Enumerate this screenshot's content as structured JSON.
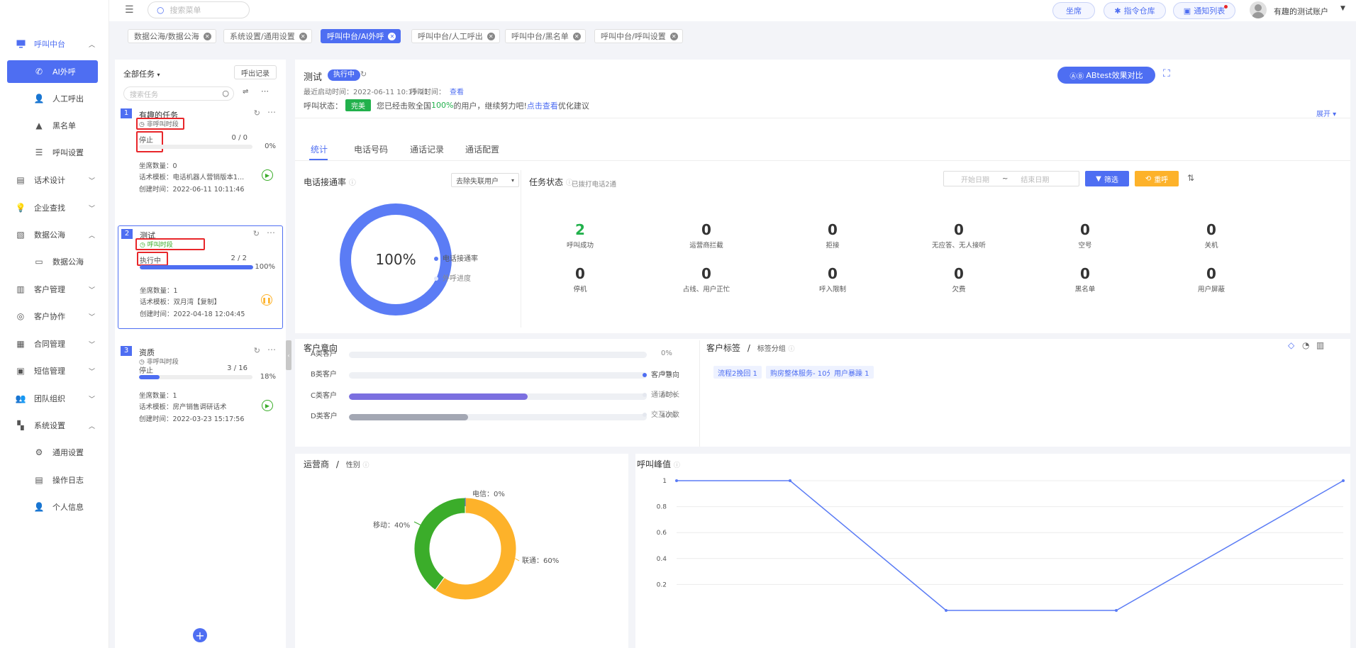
{
  "sidebar": {
    "items": [
      {
        "label": "呼叫中台",
        "icon": "monitor-icon",
        "chev": "^"
      },
      {
        "label": "AI外呼",
        "icon": "phone-icon"
      },
      {
        "label": "人工呼出",
        "icon": "person-icon"
      },
      {
        "label": "黑名单",
        "icon": "warning-icon"
      },
      {
        "label": "呼叫设置",
        "icon": "sliders-icon"
      },
      {
        "label": "话术设计",
        "icon": "book-icon",
        "chev": "v"
      },
      {
        "label": "企业查找",
        "icon": "bulb-icon",
        "chev": "v"
      },
      {
        "label": "数据公海",
        "icon": "chart-icon",
        "chev": "^"
      },
      {
        "label": "数据公海",
        "icon": "laptop-icon"
      },
      {
        "label": "客户管理",
        "icon": "contacts-icon",
        "chev": "v"
      },
      {
        "label": "客户协作",
        "icon": "team-icon",
        "chev": "v"
      },
      {
        "label": "合同管理",
        "icon": "clipboard-icon",
        "chev": "v"
      },
      {
        "label": "短信管理",
        "icon": "message-icon",
        "chev": "v"
      },
      {
        "label": "团队组织",
        "icon": "group-icon",
        "chev": "v"
      },
      {
        "label": "系统设置",
        "icon": "grid-icon",
        "chev": "^"
      },
      {
        "label": "通用设置",
        "icon": "gear-icon"
      },
      {
        "label": "操作日志",
        "icon": "doc-icon"
      },
      {
        "label": "个人信息",
        "icon": "user-icon"
      }
    ]
  },
  "topbar": {
    "search_placeholder": "搜索菜单",
    "seat": "坐席",
    "cmd": "指令仓库",
    "notify": "通知列表",
    "account": "有趣的测试账户"
  },
  "tags": [
    "数据公海/数据公海",
    "系统设置/通用设置",
    "呼叫中台/AI外呼",
    "呼叫中台/人工呼出",
    "呼叫中台/黑名单",
    "呼叫中台/呼叫设置"
  ],
  "left": {
    "filter": "全部任务",
    "export": "呼出记录",
    "search_placeholder": "搜索任务",
    "tasks": [
      {
        "num": "1",
        "title": "有趣的任务",
        "time_label": "非呼叫时段",
        "status": "停止",
        "progress": "0 / 0",
        "pct": "0%",
        "fill": 0,
        "seats": "坐席数量：0",
        "template": "话术模板：电话机器人营销版本1...",
        "created": "创建时间：2022-06-11 10:11:46"
      },
      {
        "num": "2",
        "title": "测试",
        "time_label": "呼叫时段",
        "status": "执行中",
        "progress": "2 / 2",
        "pct": "100%",
        "fill": 100,
        "seats": "坐席数量：1",
        "template": "话术模板：双月湾【复制】",
        "created": "创建时间：2022-04-18 12:04:45"
      },
      {
        "num": "3",
        "title": "资质",
        "time_label": "非呼叫时段",
        "status": "停止",
        "progress": "3 / 16",
        "pct": "18%",
        "fill": 18,
        "seats": "坐席数量：1",
        "template": "话术模板：房产销售调研话术",
        "created": "创建时间：2022-03-23 15:17:56"
      }
    ]
  },
  "main": {
    "title": "测试",
    "badge": "执行中",
    "recent_start": "最近启动时间：2022-06-11 10:19:21",
    "call_time_label": "呼叫时间：",
    "call_time_link": "查看",
    "call_status_label": "呼叫状态：",
    "call_status_badge": "完美",
    "call_status_msg1": "您已经击败全国",
    "call_status_pct": "100%",
    "call_status_msg2": "的用户，继续努力吧!",
    "call_status_link": "点击查看",
    "call_status_msg3": "优化建议",
    "ab_btn": "ABtest效果对比",
    "expand": "展开",
    "tabs": [
      "统计",
      "电话号码",
      "通话记录",
      "通话配置"
    ]
  },
  "connect": {
    "title": "电话接通率",
    "select": "去除失联用户",
    "center": "100%",
    "legend": [
      "电话接通率",
      "外呼进度"
    ]
  },
  "task_status": {
    "title": "任务状态",
    "sub": "已拨打电话2通",
    "start_placeholder": "开始日期",
    "end_placeholder": "结束日期",
    "tilde": "~",
    "filter_btn": "筛选",
    "reset_btn": "重呼",
    "stats": [
      {
        "n": "2",
        "l": "呼叫成功"
      },
      {
        "n": "0",
        "l": "运营商拦截"
      },
      {
        "n": "0",
        "l": "拒接"
      },
      {
        "n": "0",
        "l": "无应答、无人接听"
      },
      {
        "n": "0",
        "l": "空号"
      },
      {
        "n": "0",
        "l": "关机"
      },
      {
        "n": "0",
        "l": "停机"
      },
      {
        "n": "0",
        "l": "占线、用户正忙"
      },
      {
        "n": "0",
        "l": "呼入限制"
      },
      {
        "n": "0",
        "l": "欠费"
      },
      {
        "n": "0",
        "l": "黑名单"
      },
      {
        "n": "0",
        "l": "用户屏蔽"
      }
    ]
  },
  "intent": {
    "title": "客户意向",
    "rows": [
      {
        "label": "A类客户",
        "pct": "0%",
        "value": 0,
        "color": "#7b6fe0"
      },
      {
        "label": "B类客户",
        "pct": "0%",
        "value": 0,
        "color": "#7b6fe0"
      },
      {
        "label": "C类客户",
        "pct": "60%",
        "value": 60,
        "color": "#7b6fe0"
      },
      {
        "label": "D类客户",
        "pct": "40%",
        "value": 40,
        "color": "#a3a7b3"
      }
    ],
    "legend": [
      "客户意向",
      "通话时长",
      "交互次数"
    ]
  },
  "tags_panel": {
    "title": "客户标签",
    "sep": "/",
    "sub": "标签分组",
    "chips": [
      "流程2挽回 1",
      "购房整体服务- 10分 1",
      "用户暴躁 1"
    ]
  },
  "carrier": {
    "title": "运营商",
    "sep": "/",
    "sub": "性别",
    "slices": [
      {
        "name": "联通",
        "value": 60,
        "label": "联通：60%",
        "color": "#fdb22a"
      },
      {
        "name": "移动",
        "value": 40,
        "label": "移动：40%",
        "color": "#3bad2a"
      },
      {
        "name": "电信",
        "value": 0,
        "label": "电信：0%",
        "color": "#4e6ef2"
      }
    ]
  },
  "peak": {
    "title": "呼叫峰值",
    "chart_data": {
      "type": "line",
      "ylim": [
        0,
        1
      ],
      "yticks": [
        "1",
        "0.8",
        "0.6",
        "0.4",
        "0.2"
      ],
      "points": [
        1,
        1,
        0,
        0,
        1
      ]
    }
  }
}
